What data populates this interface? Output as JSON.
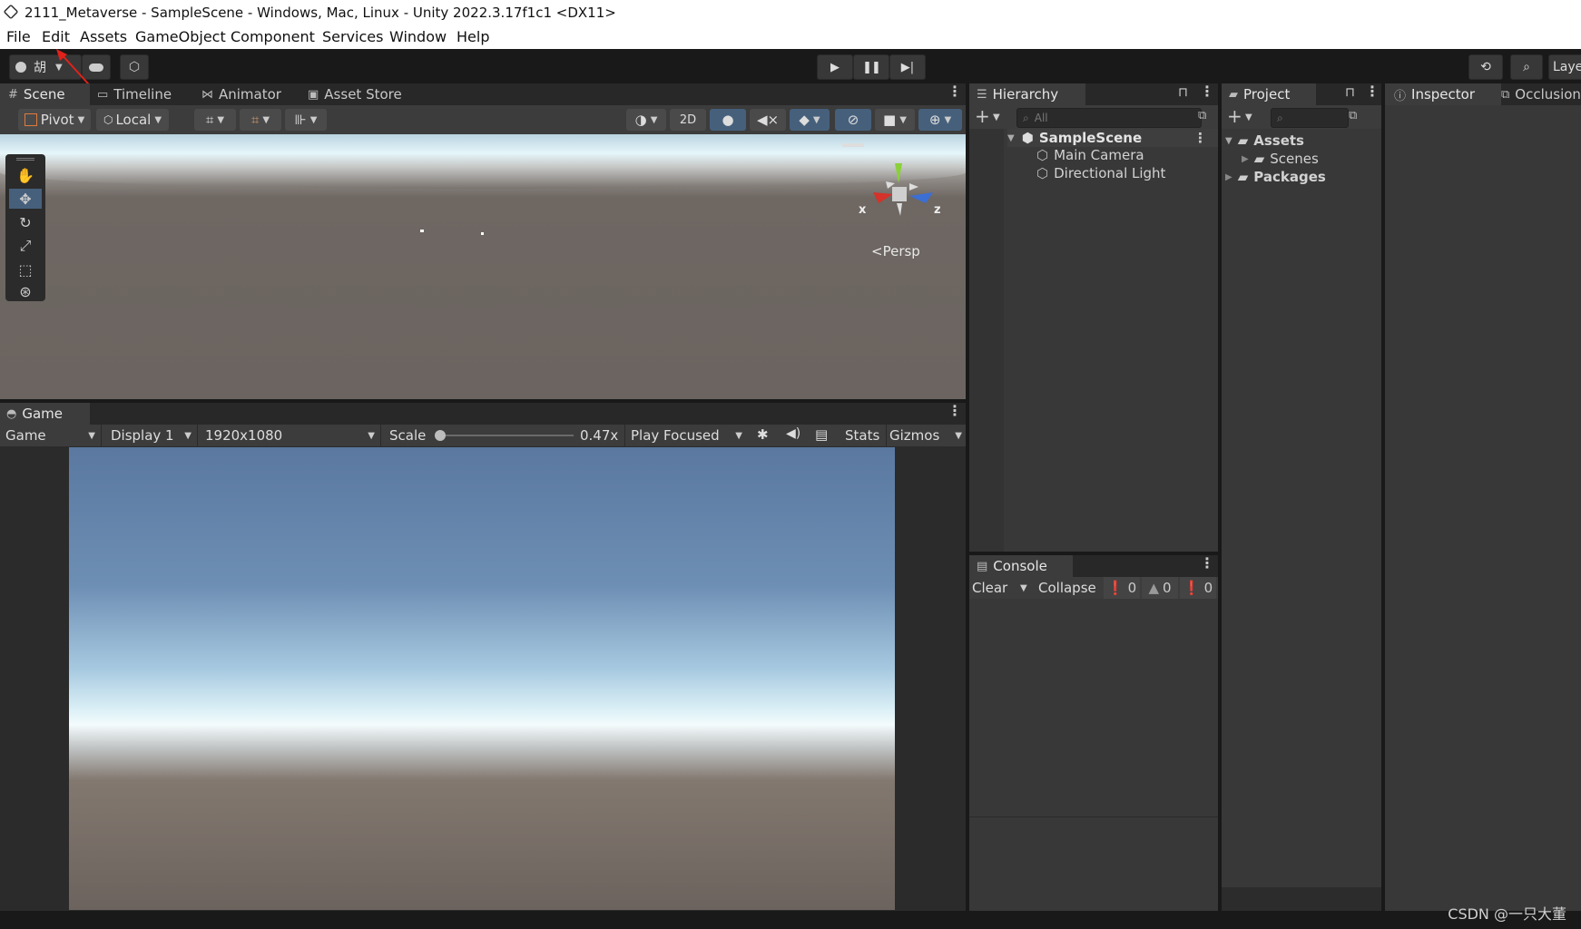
{
  "window": {
    "title": "2111_Metaverse - SampleScene - Windows, Mac, Linux - Unity 2022.3.17f1c1 <DX11>"
  },
  "menu": [
    "File",
    "Edit",
    "Assets",
    "GameObject",
    "Component",
    "Services",
    "Window",
    "Help"
  ],
  "toolbar": {
    "account_label": "胡",
    "layers_label": "Laye"
  },
  "tabs": {
    "scene": "Scene",
    "timeline": "Timeline",
    "animator": "Animator",
    "asset_store": "Asset Store"
  },
  "scene_toolbar": {
    "pivot": "Pivot",
    "local": "Local",
    "mode_2d": "2D"
  },
  "scene_view": {
    "projection": "Persp",
    "axis_x": "x",
    "axis_z": "z"
  },
  "game": {
    "tab": "Game",
    "view_select": "Game",
    "display": "Display 1",
    "resolution": "1920x1080",
    "scale_label": "Scale",
    "scale_value": "0.47x",
    "scale_fraction": 0.02,
    "play_mode": "Play Focused",
    "stats": "Stats",
    "gizmos": "Gizmos"
  },
  "hierarchy": {
    "tab": "Hierarchy",
    "search_placeholder": "All",
    "scene": "SampleScene",
    "items": [
      "Main Camera",
      "Directional Light"
    ]
  },
  "console": {
    "tab": "Console",
    "clear": "Clear",
    "collapse": "Collapse",
    "info_count": "0",
    "warn_count": "0",
    "error_count": "0"
  },
  "project": {
    "tab": "Project",
    "assets": "Assets",
    "scenes": "Scenes",
    "packages": "Packages"
  },
  "inspector": {
    "tab": "Inspector",
    "occlusion_tab": "Occlusion"
  },
  "watermark": "CSDN @一只大董"
}
